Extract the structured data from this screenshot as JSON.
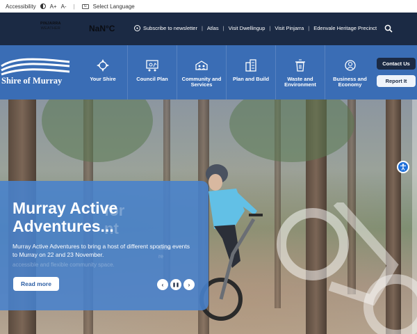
{
  "a11y": {
    "label": "Accessibility",
    "font_up": "A+",
    "font_down": "A-",
    "language": "Select Language"
  },
  "utility": {
    "weather_brand_line1": "PINJARRA",
    "weather_brand_line2": "WEATHER",
    "temperature": "NaN°C",
    "links": [
      "Subscribe to newsletter",
      "Atlas",
      "Visit Dwellingup",
      "Visit Pinjarra",
      "Edenvale Heritage Precinct"
    ]
  },
  "logo": {
    "text": "Shire of Murray"
  },
  "nav": {
    "items": [
      {
        "label": "Your Shire",
        "icon": "compass-icon"
      },
      {
        "label": "Council Plan",
        "icon": "presentation-icon"
      },
      {
        "label": "Community and Services",
        "icon": "community-icon"
      },
      {
        "label": "Plan and Build",
        "icon": "building-icon"
      },
      {
        "label": "Waste and Environment",
        "icon": "bin-icon"
      },
      {
        "label": "Business and Economy",
        "icon": "business-icon"
      }
    ],
    "contact": "Contact Us",
    "report": "Report It"
  },
  "hero": {
    "title": "Murray Active Adventures...",
    "description": "Murray Active Adventures to bring a host of different sporting events to Murray on 22 and 23 November.",
    "ghost_title": "for",
    "ghost_title_2": "nt",
    "ghost_desc": "allow",
    "ghost_desc_2": "accessible and flexible community space.",
    "ghost_desc_3": "re",
    "read_more": "Read more",
    "prev": "‹",
    "pause": "❚❚",
    "next": "›"
  },
  "colors": {
    "navy": "#1b2a44",
    "brand_blue": "#3a6db5",
    "card_blue": "#4882cd"
  }
}
